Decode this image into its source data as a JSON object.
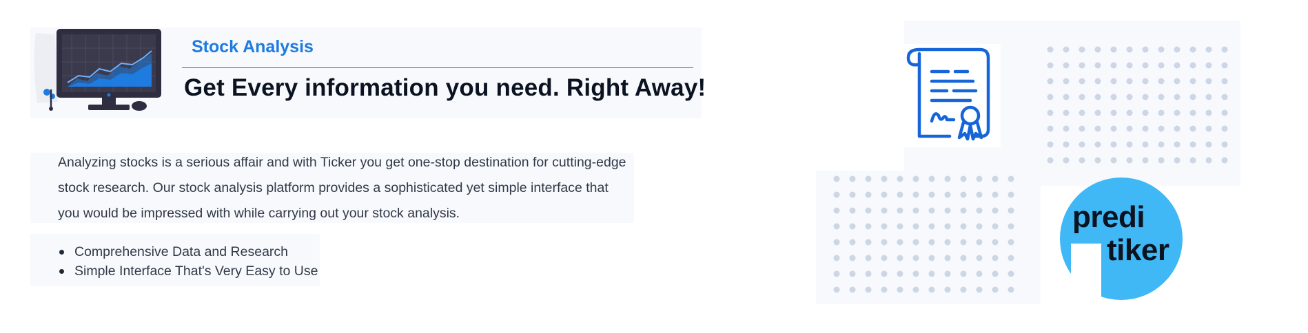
{
  "header": {
    "section_tag": "Stock Analysis",
    "headline": "Get Every information you need. Right Away!"
  },
  "body": {
    "description": "Analyzing stocks is a serious affair and with Ticker you get one-stop destination for cutting-edge stock research. Our stock analysis platform provides a sophisticated yet simple interface that you would be impressed with while carrying out your stock analysis.",
    "features": [
      "Comprehensive Data and Research",
      "Simple Interface That's Very Easy to Use"
    ]
  },
  "logo": {
    "line1": "predi",
    "line2": "tiker"
  },
  "icons": {
    "illustration": "monitor-chart-illustration",
    "certificate": "certificate-icon",
    "bullet": "bullet-dot-icon"
  },
  "colors": {
    "accent": "#1e7be0",
    "heading": "#0b1320",
    "body_text": "#303946",
    "card_bg": "#f7f9fd",
    "dot": "#cdd6e4",
    "logo_blue": "#3fb8f5",
    "cert_blue": "#1565d8"
  }
}
